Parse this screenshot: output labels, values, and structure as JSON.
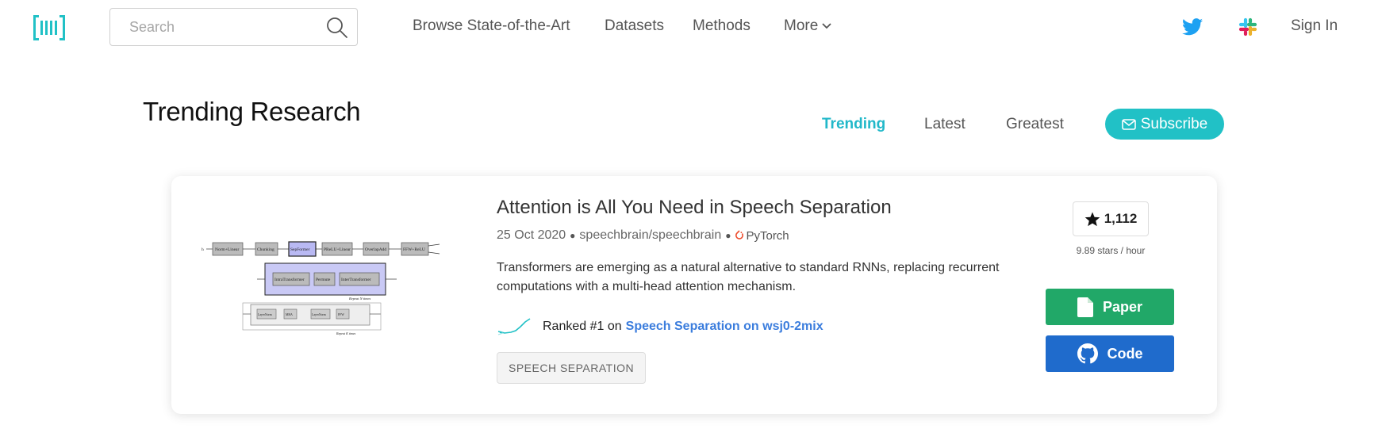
{
  "nav": {
    "search_placeholder": "Search",
    "links": [
      "Browse State-of-the-Art",
      "Datasets",
      "Methods",
      "More"
    ],
    "sign_in": "Sign In"
  },
  "page": {
    "title": "Trending Research",
    "tabs": [
      "Trending",
      "Latest",
      "Greatest"
    ],
    "active_tab": "Trending",
    "subscribe_label": "Subscribe"
  },
  "paper": {
    "title": "Attention is All You Need in Speech Separation",
    "date": "25 Oct 2020",
    "repo": "speechbrain/speechbrain",
    "framework": "PyTorch",
    "abstract": "Transformers are emerging as a natural alternative to standard RNNs, replacing recurrent computations with a multi-head attention mechanism.",
    "rank_prefix": "Ranked #1 on",
    "rank_task": "Speech Separation on wsj0-2mix",
    "task_tag": "SPEECH SEPARATION",
    "stars": "1,112",
    "stars_rate": "9.89 stars / hour",
    "paper_button": "Paper",
    "code_button": "Code"
  },
  "thumbnail": {
    "blocks_row1": [
      "Norm+Linear",
      "Chunking",
      "SepFormer",
      "PReLU+Linear",
      "OverlapAdd",
      "FFW+ReLU"
    ],
    "blocks_row2": [
      "IntraTransformer",
      "Permute",
      "InterTransformer"
    ],
    "repeat_label": "Repeat N times",
    "blocks_row3": [
      "LayerNorm",
      "MHA",
      "LayerNorm",
      "FFW"
    ],
    "repeat_label_2": "Repeat K times"
  },
  "colors": {
    "accent": "#21c1c6",
    "active_tab": "#21b8c9",
    "paper_button": "#21a868",
    "code_button": "#1f6bcc",
    "link": "#3b7ddd",
    "twitter": "#1da1f2"
  }
}
